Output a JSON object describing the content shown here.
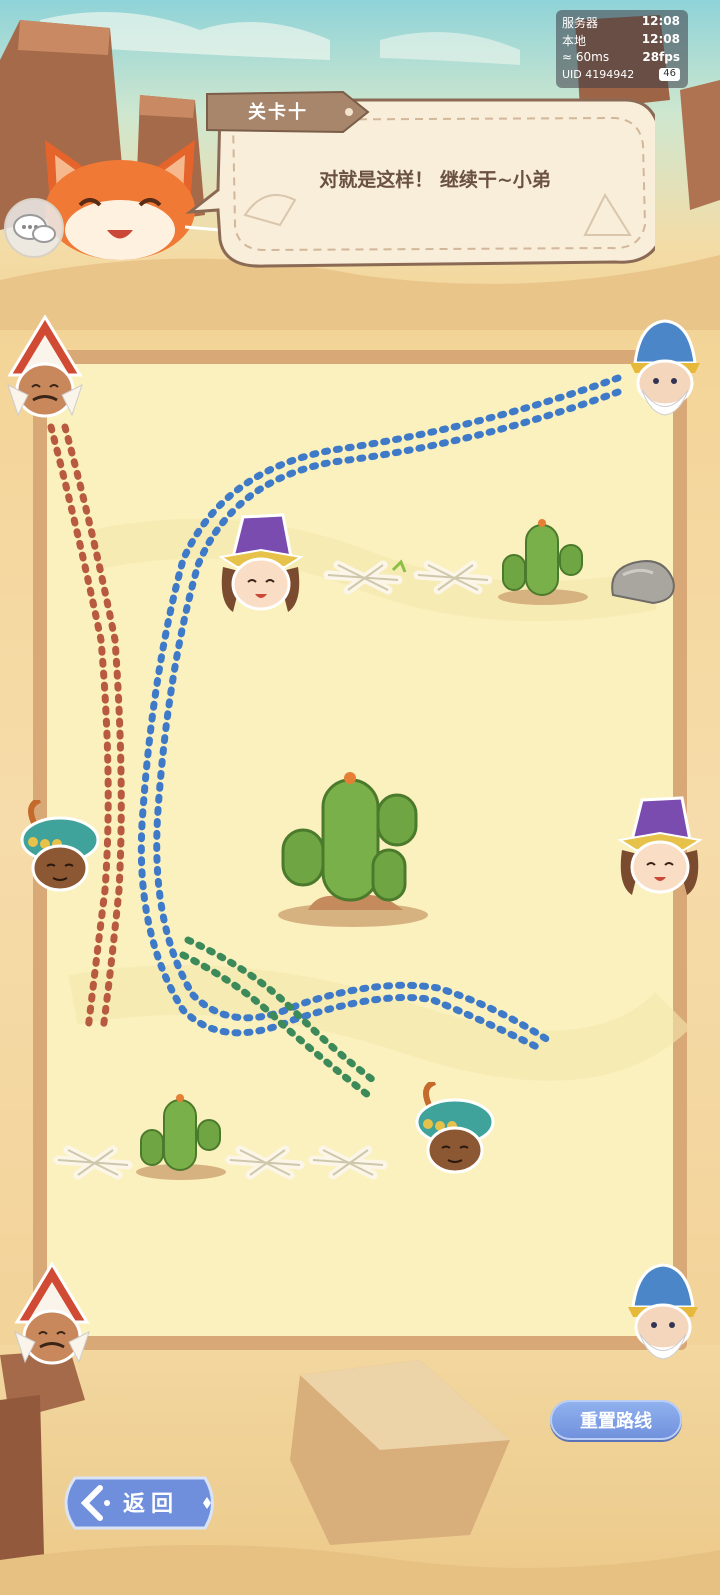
{
  "status": {
    "server_label": "服务器",
    "server_time": "12:08",
    "local_label": "本地",
    "local_time": "12:08",
    "ping": "60ms",
    "fps": "28fps",
    "uid_label": "UID",
    "uid": "4194942",
    "battery": "46"
  },
  "level": {
    "title": "关卡十"
  },
  "dialog": {
    "text": "对就是这样！ 继续干~小弟"
  },
  "buttons": {
    "reset": "重置路线",
    "back": "返回"
  },
  "colors": {
    "path_red": "#b85a40",
    "path_blue": "#3f7ac8",
    "path_green": "#3c8a5a",
    "board_fill": "#fbf1be",
    "board_frame": "#d9a877",
    "button_blue": "#7b98e0"
  },
  "board": {
    "characters": [
      {
        "name": "red-hat-elder",
        "side": "left",
        "row": "top"
      },
      {
        "name": "blue-hat-elder",
        "side": "right",
        "row": "top"
      },
      {
        "name": "purple-hat-girl",
        "side": "inner",
        "row": "upper"
      },
      {
        "name": "turban-boy",
        "side": "left",
        "row": "middle"
      },
      {
        "name": "purple-hat-girl",
        "side": "right",
        "row": "middle"
      },
      {
        "name": "turban-boy",
        "side": "inner",
        "row": "lower"
      },
      {
        "name": "red-hat-elder",
        "side": "left",
        "row": "bottom"
      },
      {
        "name": "blue-hat-elder",
        "side": "right",
        "row": "bottom"
      }
    ],
    "obstacles": [
      "bones",
      "bones",
      "cactus",
      "rock",
      "big-cactus",
      "bones",
      "cactus",
      "bones",
      "bones"
    ]
  }
}
